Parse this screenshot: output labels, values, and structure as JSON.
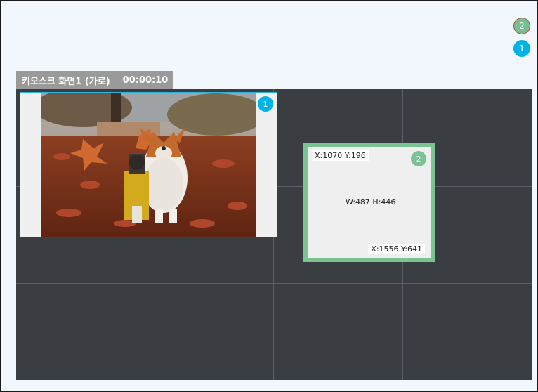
{
  "layer_badges": [
    "2",
    "1"
  ],
  "screen": {
    "name": "키오스크 화면1 (가로)",
    "duration": "00:00:10"
  },
  "regions": [
    {
      "num": "1",
      "content": "corgi-autumn-photo"
    },
    {
      "num": "2",
      "top_left": "X:1070 Y:196",
      "size": "W:487 H:446",
      "bottom_right": "X:1556 Y:641"
    }
  ],
  "colors": {
    "region1": "#00b3e6",
    "region2": "#7cc394",
    "canvas": "#3a3e43"
  }
}
